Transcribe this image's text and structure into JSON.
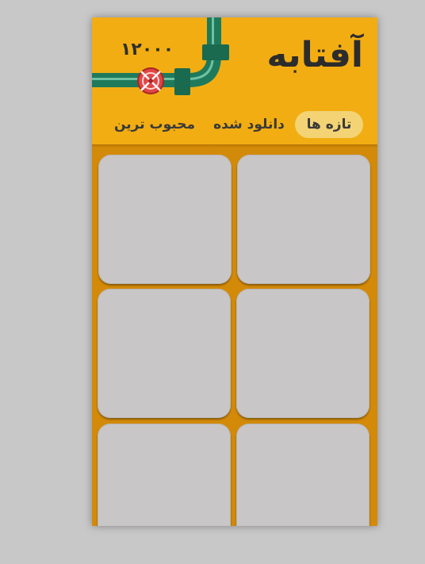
{
  "app": {
    "title": "آفتابه",
    "coins": "۱۲۰۰۰"
  },
  "tabs": [
    {
      "label": "تازه ها",
      "active": true
    },
    {
      "label": "دانلود شده",
      "active": false
    },
    {
      "label": "محبوب ترین",
      "active": false
    }
  ],
  "colors": {
    "header": "#f2ad13",
    "background": "#d38a08",
    "pipe": "#1f7a5c",
    "valve": "#e04646",
    "active_tab": "#f3d374",
    "card": "#c8c6c6"
  },
  "icons": {
    "pipe": "pipe-illustration-icon",
    "valve": "valve-icon"
  },
  "grid": {
    "card_count": 6
  }
}
